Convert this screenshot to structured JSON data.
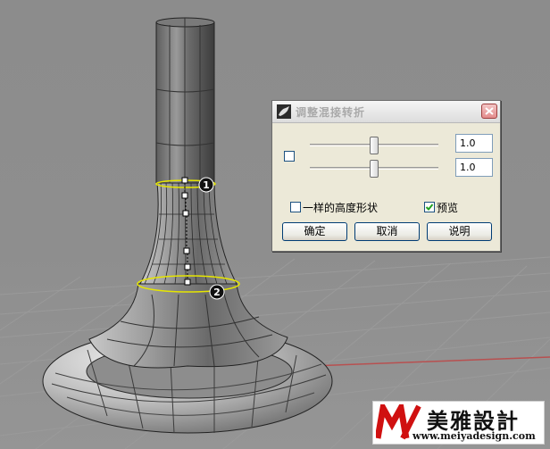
{
  "dialog": {
    "title": "调整混接转折",
    "slider_1": {
      "value": "1.0",
      "level": 0.5
    },
    "slider_2": {
      "value": "1.0",
      "level": 0.5
    },
    "main_checkbox": {
      "checked": false
    },
    "same_height_option": {
      "label": "一样的高度形状",
      "checked": false
    },
    "preview_option": {
      "label": "预览",
      "checked": true
    },
    "buttons": {
      "ok": "确定",
      "cancel": "取消",
      "help": "说明"
    }
  },
  "viewport": {
    "control_point_markers": [
      "1",
      "2"
    ]
  },
  "watermark": {
    "logo_text": "M",
    "brand": "美雅設計",
    "url": "www.meiyadesign.com"
  }
}
